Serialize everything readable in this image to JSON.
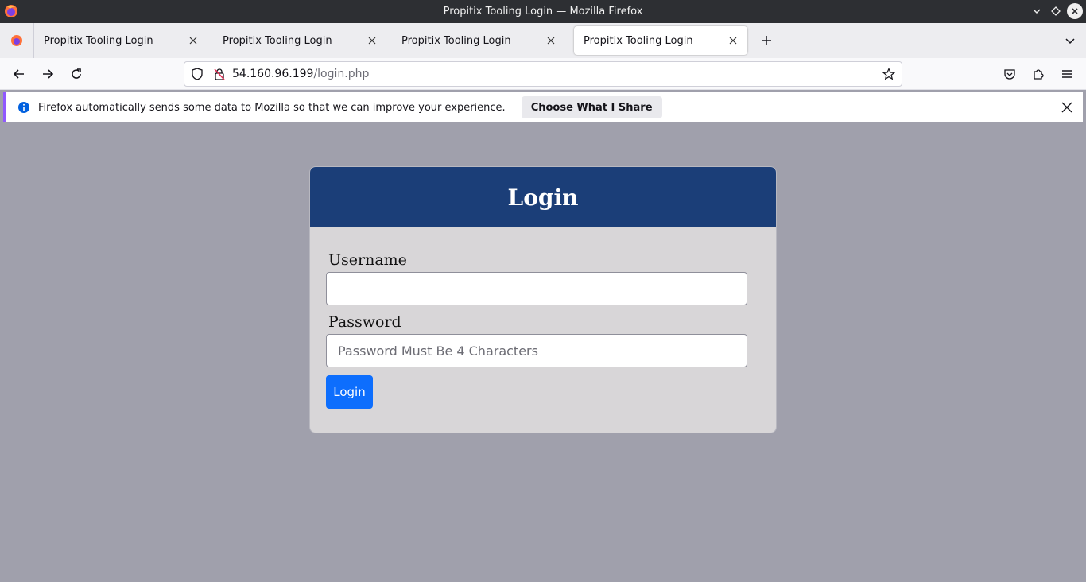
{
  "window": {
    "title": "Propitix Tooling Login — Mozilla Firefox"
  },
  "tabs": [
    {
      "label": "Propitix Tooling Login",
      "active": false
    },
    {
      "label": "Propitix Tooling Login",
      "active": false
    },
    {
      "label": "Propitix Tooling Login",
      "active": false
    },
    {
      "label": "Propitix Tooling Login",
      "active": true
    }
  ],
  "address_bar": {
    "host": "54.160.96.199",
    "path": "/login.php"
  },
  "notification": {
    "message": "Firefox automatically sends some data to Mozilla so that we can improve your experience.",
    "button_label": "Choose What I Share"
  },
  "login_form": {
    "heading": "Login",
    "username_label": "Username",
    "username_value": "",
    "password_label": "Password",
    "password_placeholder": "Password Must Be 4 Characters",
    "submit_label": "Login"
  },
  "colors": {
    "page_background": "#a0a0ac",
    "card_header": "#1b3e78",
    "card_body": "#d8d6d8",
    "primary_button": "#0d6efd",
    "notification_accent": "#9059ff"
  },
  "icons": {
    "app": "firefox-logo-icon",
    "back": "arrow-left-icon",
    "forward": "arrow-right-icon",
    "reload": "reload-icon",
    "shield": "shield-icon",
    "insecure": "insecure-lock-icon",
    "bookmark": "star-icon",
    "pocket": "pocket-icon",
    "extensions": "puzzle-icon",
    "menu": "hamburger-menu-icon",
    "info": "info-icon",
    "close": "close-icon",
    "new_tab": "plus-icon",
    "list_tabs": "chevron-down-icon"
  }
}
